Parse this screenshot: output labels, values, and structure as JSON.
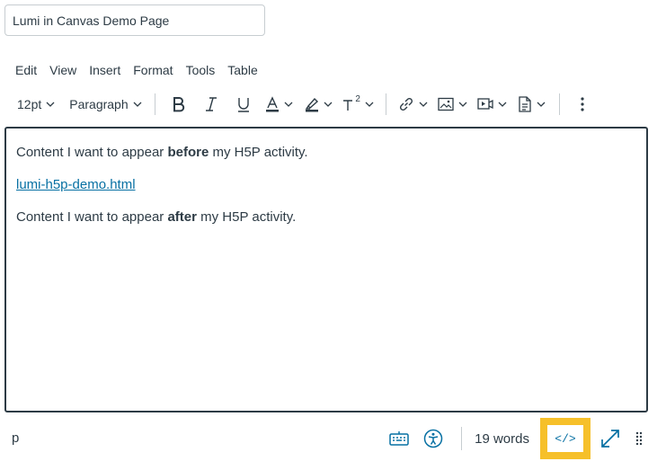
{
  "page_title_value": "Lumi in Canvas Demo Page",
  "menubar": [
    "Edit",
    "View",
    "Insert",
    "Format",
    "Tools",
    "Table"
  ],
  "toolbar": {
    "font_size": "12pt",
    "block_format": "Paragraph",
    "superscript_label": "2"
  },
  "content": {
    "p1_before": "Content I want to appear ",
    "p1_bold": "before",
    "p1_after": " my H5P activity.",
    "link_text": "lumi-h5p-demo.html",
    "p3_before": "Content I want to appear ",
    "p3_bold": "after",
    "p3_after": " my H5P activity."
  },
  "statusbar": {
    "path": "p",
    "word_count": "19 words",
    "html_editor_label": "</>"
  },
  "colors": {
    "text": "#2d3b45",
    "link": "#0770a3",
    "highlight": "#f6c02a",
    "border": "#c7cdd1"
  }
}
